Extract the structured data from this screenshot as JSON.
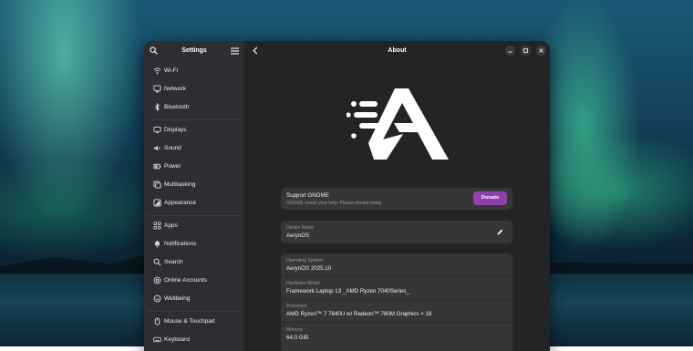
{
  "sidebar": {
    "title": "Settings",
    "items": [
      {
        "label": "Wi-Fi",
        "icon": "wifi-icon"
      },
      {
        "label": "Network",
        "icon": "network-icon"
      },
      {
        "label": "Bluetooth",
        "icon": "bluetooth-icon"
      },
      {
        "label": "Displays",
        "icon": "display-icon"
      },
      {
        "label": "Sound",
        "icon": "sound-icon"
      },
      {
        "label": "Power",
        "icon": "power-icon"
      },
      {
        "label": "Multitasking",
        "icon": "multitasking-icon"
      },
      {
        "label": "Appearance",
        "icon": "appearance-icon"
      },
      {
        "label": "Apps",
        "icon": "apps-icon"
      },
      {
        "label": "Notifications",
        "icon": "bell-icon"
      },
      {
        "label": "Search",
        "icon": "search-icon"
      },
      {
        "label": "Online Accounts",
        "icon": "at-icon"
      },
      {
        "label": "Wellbeing",
        "icon": "wellbeing-icon"
      },
      {
        "label": "Mouse & Touchpad",
        "icon": "mouse-icon"
      },
      {
        "label": "Keyboard",
        "icon": "keyboard-icon"
      }
    ]
  },
  "main": {
    "title": "About",
    "support": {
      "title": "Support GNOME",
      "subtitle": "GNOME needs your help. Please donate today.",
      "button": "Donate"
    },
    "device": {
      "label": "Device Name",
      "value": "AerynOS"
    },
    "specs": [
      {
        "label": "Operating System",
        "value": "AerynOS 2025.10"
      },
      {
        "label": "Hardware Model",
        "value": "Framework Laptop 13 _AMD Ryzen 7040Series_"
      },
      {
        "label": "Processor",
        "value": "AMD Ryzen™ 7 7840U w/ Radeon™ 780M Graphics × 16"
      },
      {
        "label": "Memory",
        "value": "64.0 GiB"
      }
    ]
  },
  "colors": {
    "accent": "#9141ac",
    "window_bg": "#242424",
    "sidebar_bg": "#2e2e32",
    "card_bg": "#363638"
  }
}
